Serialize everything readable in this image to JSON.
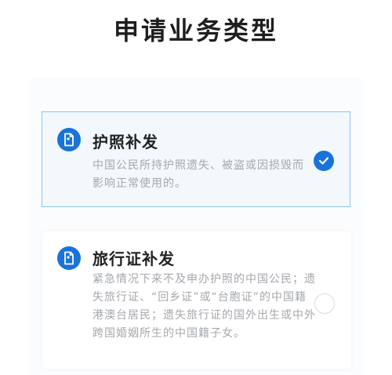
{
  "header": {
    "title": "申请业务类型"
  },
  "options": [
    {
      "title": "护照补发",
      "description": "中国公民所持护照遗失、被盗或因损毁而影响正常使用的。",
      "selected": true,
      "icon": "passport-icon"
    },
    {
      "title": "旅行证补发",
      "description": "紧急情况下来不及申办护照的中国公民；遗失旅行证、“回乡证”或“台胞证”的中国籍港澳台居民；遗失旅行证的国外出生或中外跨国婚姻所生的中国籍子女。",
      "selected": false,
      "icon": "passport-icon"
    }
  ],
  "colors": {
    "accent": "#1a73d9",
    "selected_border": "#8fc2ee",
    "selected_bg": "#f3f8fd"
  }
}
